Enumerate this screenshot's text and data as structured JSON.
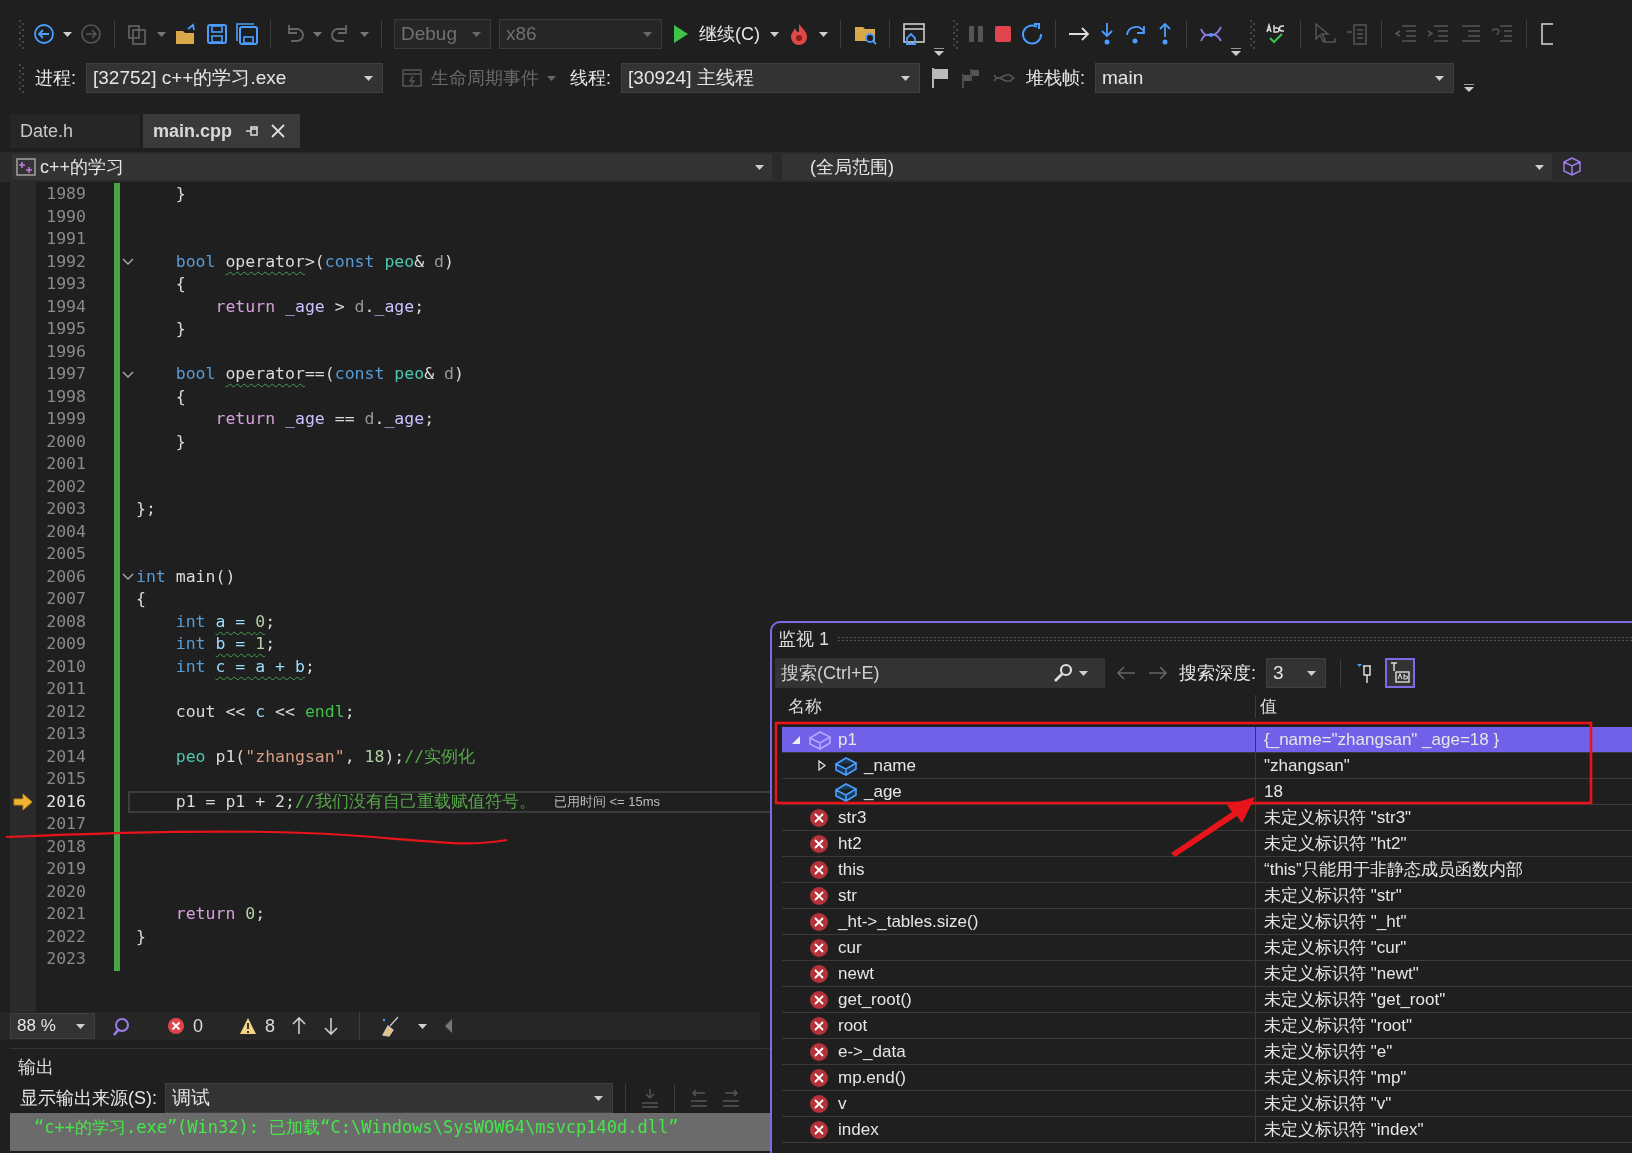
{
  "toolbar": {
    "config": {
      "label": "Debug",
      "disabled": true
    },
    "platform": {
      "label": "x86",
      "disabled": true
    },
    "continue_label": "继续(C)"
  },
  "debug_location": {
    "process_label": "进程:",
    "process": "[32752] c++的学习.exe",
    "lifecycle": {
      "label": "生命周期事件",
      "disabled": true
    },
    "thread_label": "线程:",
    "thread": "[30924] 主线程",
    "stack_label": "堆栈帧:",
    "stack_frame": "main"
  },
  "tabs": [
    {
      "label": "Date.h",
      "selected": false
    },
    {
      "label": "main.cpp",
      "selected": true
    }
  ],
  "nav_bar": {
    "project": "c++的学习",
    "scope": "(全局范围)"
  },
  "editor": {
    "lines": [
      {
        "number": "1989",
        "fold": false,
        "current": false,
        "tokens": [
          {
            "kind": "plain",
            "text": "    }",
            "squiggle": false
          }
        ]
      },
      {
        "number": "1990",
        "fold": false,
        "current": false
      },
      {
        "number": "1991",
        "fold": false,
        "current": false
      },
      {
        "number": "1992",
        "fold": true,
        "current": false,
        "tokens": [
          {
            "kind": "keyword",
            "text": "    bool ",
            "squiggle": false
          },
          {
            "kind": "plain",
            "text": "operator",
            "squiggle": true
          },
          {
            "kind": "plain",
            "text": ">(",
            "squiggle": false
          },
          {
            "kind": "keyword",
            "text": "const ",
            "squiggle": false
          },
          {
            "kind": "type",
            "text": "peo",
            "squiggle": false
          },
          {
            "kind": "plain",
            "text": "& ",
            "squiggle": false
          },
          {
            "kind": "param",
            "text": "d",
            "squiggle": false
          },
          {
            "kind": "plain",
            "text": ")",
            "squiggle": false
          }
        ]
      },
      {
        "number": "1993",
        "fold": false,
        "current": false,
        "tokens": [
          {
            "kind": "plain",
            "text": "    {",
            "squiggle": false
          }
        ]
      },
      {
        "number": "1994",
        "fold": false,
        "current": false,
        "tokens": [
          {
            "kind": "control",
            "text": "        return ",
            "squiggle": false
          },
          {
            "kind": "field",
            "text": "_age",
            "squiggle": false
          },
          {
            "kind": "plain",
            "text": " > ",
            "squiggle": false
          },
          {
            "kind": "param",
            "text": "d",
            "squiggle": false
          },
          {
            "kind": "plain",
            "text": ".",
            "squiggle": false
          },
          {
            "kind": "field",
            "text": "_age",
            "squiggle": false
          },
          {
            "kind": "plain",
            "text": ";",
            "squiggle": false
          }
        ]
      },
      {
        "number": "1995",
        "fold": false,
        "current": false,
        "tokens": [
          {
            "kind": "plain",
            "text": "    }",
            "squiggle": false
          }
        ]
      },
      {
        "number": "1996",
        "fold": false,
        "current": false
      },
      {
        "number": "1997",
        "fold": true,
        "current": false,
        "tokens": [
          {
            "kind": "keyword",
            "text": "    bool ",
            "squiggle": false
          },
          {
            "kind": "plain",
            "text": "operator",
            "squiggle": true
          },
          {
            "kind": "plain",
            "text": "==(",
            "squiggle": false
          },
          {
            "kind": "keyword",
            "text": "const ",
            "squiggle": false
          },
          {
            "kind": "type",
            "text": "peo",
            "squiggle": false
          },
          {
            "kind": "plain",
            "text": "& ",
            "squiggle": false
          },
          {
            "kind": "param",
            "text": "d",
            "squiggle": false
          },
          {
            "kind": "plain",
            "text": ")",
            "squiggle": false
          }
        ]
      },
      {
        "number": "1998",
        "fold": false,
        "current": false,
        "tokens": [
          {
            "kind": "plain",
            "text": "    {",
            "squiggle": false
          }
        ]
      },
      {
        "number": "1999",
        "fold": false,
        "current": false,
        "tokens": [
          {
            "kind": "control",
            "text": "        return ",
            "squiggle": false
          },
          {
            "kind": "field",
            "text": "_age",
            "squiggle": false
          },
          {
            "kind": "plain",
            "text": " == ",
            "squiggle": false
          },
          {
            "kind": "param",
            "text": "d",
            "squiggle": false
          },
          {
            "kind": "plain",
            "text": ".",
            "squiggle": false
          },
          {
            "kind": "field",
            "text": "_age",
            "squiggle": false
          },
          {
            "kind": "plain",
            "text": ";",
            "squiggle": false
          }
        ]
      },
      {
        "number": "2000",
        "fold": false,
        "current": false,
        "tokens": [
          {
            "kind": "plain",
            "text": "    }",
            "squiggle": false
          }
        ]
      },
      {
        "number": "2001",
        "fold": false,
        "current": false
      },
      {
        "number": "2002",
        "fold": false,
        "current": false
      },
      {
        "number": "2003",
        "fold": false,
        "current": false,
        "tokens": [
          {
            "kind": "plain",
            "text": "};",
            "squiggle": false
          }
        ]
      },
      {
        "number": "2004",
        "fold": false,
        "current": false
      },
      {
        "number": "2005",
        "fold": false,
        "current": false
      },
      {
        "number": "2006",
        "fold": true,
        "current": false,
        "tokens": [
          {
            "kind": "keyword",
            "text": "int ",
            "squiggle": false
          },
          {
            "kind": "plain",
            "text": "main()",
            "squiggle": false
          }
        ]
      },
      {
        "number": "2007",
        "fold": false,
        "current": false,
        "tokens": [
          {
            "kind": "plain",
            "text": "{",
            "squiggle": false
          }
        ]
      },
      {
        "number": "2008",
        "fold": false,
        "current": false,
        "tokens": [
          {
            "kind": "keyword",
            "text": "    int ",
            "squiggle": false
          },
          {
            "kind": "var",
            "text": "a = ",
            "squiggle": true
          },
          {
            "kind": "number",
            "text": "0",
            "squiggle": true
          },
          {
            "kind": "plain",
            "text": ";",
            "squiggle": false
          }
        ]
      },
      {
        "number": "2009",
        "fold": false,
        "current": false,
        "tokens": [
          {
            "kind": "keyword",
            "text": "    int ",
            "squiggle": false
          },
          {
            "kind": "var",
            "text": "b = ",
            "squiggle": true
          },
          {
            "kind": "number",
            "text": "1",
            "squiggle": true
          },
          {
            "kind": "plain",
            "text": ";",
            "squiggle": false
          }
        ]
      },
      {
        "number": "2010",
        "fold": false,
        "current": false,
        "tokens": [
          {
            "kind": "keyword",
            "text": "    int ",
            "squiggle": false
          },
          {
            "kind": "var",
            "text": "c = a + b",
            "squiggle": true
          },
          {
            "kind": "plain",
            "text": ";",
            "squiggle": false
          }
        ]
      },
      {
        "number": "2011",
        "fold": false,
        "current": false
      },
      {
        "number": "2012",
        "fold": false,
        "current": false,
        "tokens": [
          {
            "kind": "plain",
            "text": "    cout << ",
            "squiggle": false
          },
          {
            "kind": "var",
            "text": "c",
            "squiggle": false
          },
          {
            "kind": "plain",
            "text": " << ",
            "squiggle": false
          },
          {
            "kind": "builtin",
            "text": "endl",
            "squiggle": false
          },
          {
            "kind": "plain",
            "text": ";",
            "squiggle": false
          }
        ]
      },
      {
        "number": "2013",
        "fold": false,
        "current": false
      },
      {
        "number": "2014",
        "fold": false,
        "current": false,
        "tokens": [
          {
            "kind": "type",
            "text": "    peo",
            "squiggle": false
          },
          {
            "kind": "plain",
            "text": " p1(",
            "squiggle": false
          },
          {
            "kind": "string",
            "text": "\"zhangsan\"",
            "squiggle": false
          },
          {
            "kind": "plain",
            "text": ", ",
            "squiggle": false
          },
          {
            "kind": "number",
            "text": "18",
            "squiggle": false
          },
          {
            "kind": "plain",
            "text": ");",
            "squiggle": false
          },
          {
            "kind": "comment",
            "text": "//实例化",
            "squiggle": false
          }
        ]
      },
      {
        "number": "2015",
        "fold": false,
        "current": false
      },
      {
        "number": "2016",
        "fold": false,
        "current": true,
        "hint": "已用时间 <= 15ms",
        "tokens": [
          {
            "kind": "plain",
            "text": "    p1 = p1 + 2;",
            "squiggle": false
          },
          {
            "kind": "comment",
            "text": "//我们没有自己重载赋值符号。",
            "squiggle": false
          }
        ]
      },
      {
        "number": "2017",
        "fold": false,
        "current": false
      },
      {
        "number": "2018",
        "fold": false,
        "current": false
      },
      {
        "number": "2019",
        "fold": false,
        "current": false
      },
      {
        "number": "2020",
        "fold": false,
        "current": false
      },
      {
        "number": "2021",
        "fold": false,
        "current": false,
        "tokens": [
          {
            "kind": "control",
            "text": "    return ",
            "squiggle": false
          },
          {
            "kind": "number",
            "text": "0",
            "squiggle": false
          },
          {
            "kind": "plain",
            "text": ";",
            "squiggle": false
          }
        ]
      },
      {
        "number": "2022",
        "fold": false,
        "current": false,
        "tokens": [
          {
            "kind": "plain",
            "text": "}",
            "squiggle": false
          }
        ]
      },
      {
        "number": "2023",
        "fold": false,
        "current": false
      }
    ],
    "status": {
      "zoom": "88 %",
      "errors": "0",
      "warnings": "8"
    }
  },
  "output": {
    "title": "输出",
    "source_label": "显示输出来源(S):",
    "source": "调试",
    "lines": [
      "“c++的学习.exe”(Win32): 已加载“C:\\Windows\\SysWOW64\\msvcp140d.dll”"
    ]
  },
  "watch": {
    "title": "监视 1",
    "search_placeholder": "搜索(Ctrl+E)",
    "depth_label": "搜索深度:",
    "depth": "3",
    "columns": [
      "名称",
      "值"
    ],
    "rows": [
      {
        "name": "p1",
        "value": "{_name=\"zhangsan\" _age=18 }",
        "kind": "object",
        "expandable": true,
        "expanded": true,
        "selected": true,
        "children": [
          {
            "name": "_name",
            "value": "\"zhangsan\"",
            "kind": "field",
            "expandable": true,
            "expanded": false,
            "selected": false
          },
          {
            "name": "_age",
            "value": "18",
            "kind": "field",
            "expandable": false,
            "selected": false
          }
        ]
      },
      {
        "name": "str3",
        "value": "未定义标识符 \"str3\"",
        "kind": "error",
        "expandable": false,
        "selected": false
      },
      {
        "name": "ht2",
        "value": "未定义标识符 \"ht2\"",
        "kind": "error",
        "expandable": false,
        "selected": false
      },
      {
        "name": "this",
        "value": "“this”只能用于非静态成员函数内部",
        "kind": "error",
        "expandable": false,
        "selected": false
      },
      {
        "name": "str",
        "value": "未定义标识符 \"str\"",
        "kind": "error",
        "expandable": false,
        "selected": false
      },
      {
        "name": "_ht->_tables.size()",
        "value": "未定义标识符 \"_ht\"",
        "kind": "error",
        "expandable": false,
        "selected": false
      },
      {
        "name": "cur",
        "value": "未定义标识符 \"cur\"",
        "kind": "error",
        "expandable": false,
        "selected": false
      },
      {
        "name": "newt",
        "value": "未定义标识符 \"newt\"",
        "kind": "error",
        "expandable": false,
        "selected": false
      },
      {
        "name": "get_root()",
        "value": "未定义标识符 \"get_root\"",
        "kind": "error",
        "expandable": false,
        "selected": false
      },
      {
        "name": "root",
        "value": "未定义标识符 \"root\"",
        "kind": "error",
        "expandable": false,
        "selected": false
      },
      {
        "name": "e->_data",
        "value": "未定义标识符 \"e\"",
        "kind": "error",
        "expandable": false,
        "selected": false
      },
      {
        "name": "mp.end()",
        "value": "未定义标识符 \"mp\"",
        "kind": "error",
        "expandable": false,
        "selected": false
      },
      {
        "name": "v",
        "value": "未定义标识符 \"v\"",
        "kind": "error",
        "expandable": false,
        "selected": false
      },
      {
        "name": "index",
        "value": "未定义标识符 \"index\"",
        "kind": "error",
        "expandable": false,
        "selected": false
      }
    ]
  }
}
